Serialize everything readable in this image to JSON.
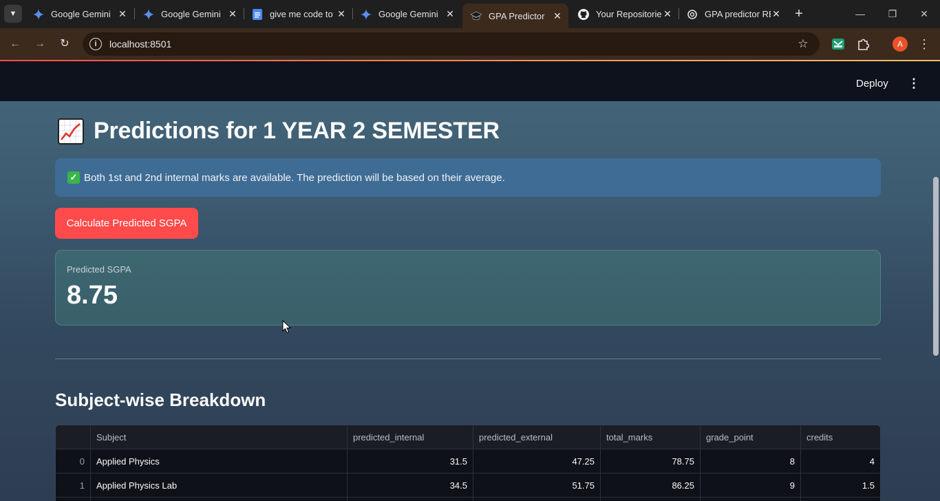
{
  "browser": {
    "tabs": [
      {
        "title": "Google Gemini",
        "icon": "gemini-icon",
        "active": false
      },
      {
        "title": "Google Gemini",
        "icon": "gemini-icon",
        "active": false
      },
      {
        "title": "give me code to",
        "icon": "docs-icon",
        "active": false
      },
      {
        "title": "Google Gemini",
        "icon": "gemini-icon",
        "active": false
      },
      {
        "title": "GPA Predictor",
        "icon": "graduation-cap-icon",
        "active": true
      },
      {
        "title": "Your Repositorie",
        "icon": "github-icon",
        "active": false
      },
      {
        "title": "GPA predictor RE",
        "icon": "openai-icon",
        "active": false
      }
    ],
    "url": "localhost:8501",
    "profile_initial": "A"
  },
  "app_header": {
    "deploy_label": "Deploy"
  },
  "page": {
    "title": "Predictions for 1 YEAR 2 SEMESTER",
    "info_message": "Both 1st and 2nd internal marks are available. The prediction will be based on their average.",
    "calculate_button": "Calculate Predicted SGPA",
    "metric": {
      "label": "Predicted SGPA",
      "value": "8.75"
    },
    "section_title": "Subject-wise Breakdown"
  },
  "table": {
    "headers": [
      "",
      "Subject",
      "predicted_internal",
      "predicted_external",
      "total_marks",
      "grade_point",
      "credits"
    ],
    "rows": [
      [
        "0",
        "Applied Physics",
        "31.5",
        "47.25",
        "78.75",
        "8",
        "4"
      ],
      [
        "1",
        "Applied Physics Lab",
        "34.5",
        "51.75",
        "86.25",
        "9",
        "1.5"
      ]
    ]
  },
  "colors": {
    "accent_red": "#ff4b4b",
    "info_blue": "#3f6c95",
    "success_green": "#3ab54a"
  }
}
